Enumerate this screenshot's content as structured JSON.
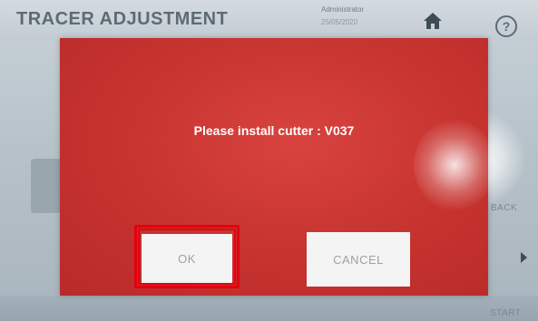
{
  "header": {
    "title": "TRACER ADJUSTMENT",
    "user": "Administrator",
    "date": "25/05/2020",
    "home_icon": "home-icon",
    "help_icon": "help-icon",
    "help_glyph": "?"
  },
  "side": {
    "back_label": "BACK",
    "start_label": "START"
  },
  "dialog": {
    "message": "Please install cutter : V037",
    "ok_label": "OK",
    "cancel_label": "CANCEL",
    "background_color": "#c93531",
    "highlight_color": "#e3000f"
  }
}
